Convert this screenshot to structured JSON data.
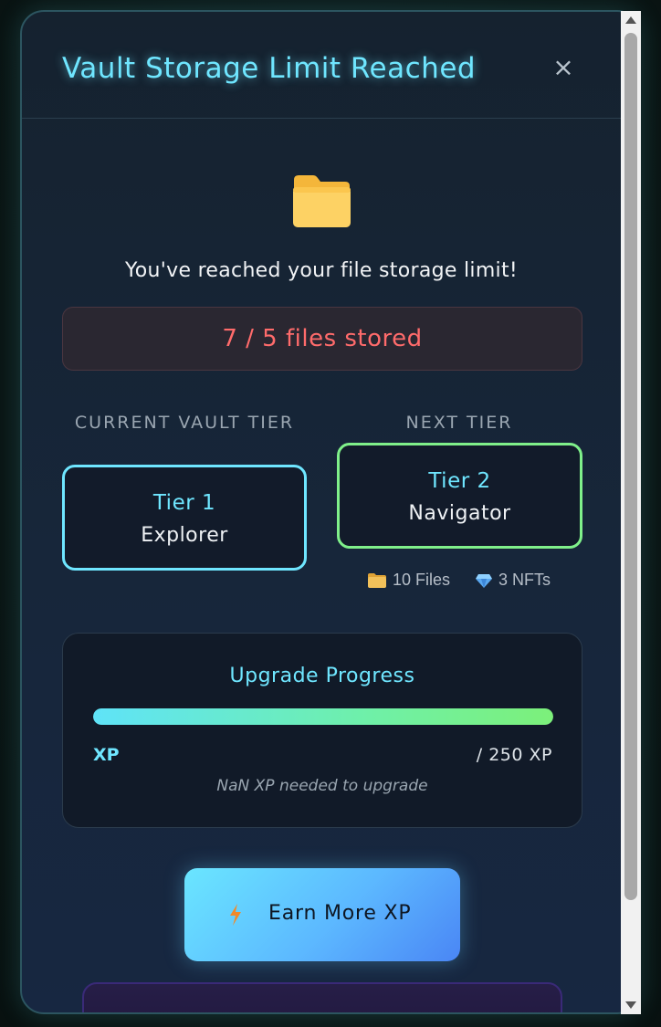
{
  "modal": {
    "title": "Vault Storage Limit Reached",
    "close_symbol": "×",
    "icon": "folder-icon",
    "message": "You've reached your file storage limit!",
    "files_stored": "7 / 5 files stored"
  },
  "tiers": {
    "current": {
      "label": "CURRENT VAULT TIER",
      "name": "Tier 1",
      "description": "Explorer",
      "border_color": "#6fe6ff"
    },
    "next": {
      "label": "NEXT TIER",
      "name": "Tier 2",
      "description": "Navigator",
      "border_color": "#7ff08a",
      "perks": {
        "files": {
          "icon": "folder-icon",
          "text": "10 Files"
        },
        "nfts": {
          "icon": "gem-icon",
          "text": "3 NFTs"
        }
      }
    }
  },
  "progress": {
    "title": "Upgrade Progress",
    "fill_fraction": 1.0,
    "current_xp": "XP",
    "target_xp": "/ 250 XP",
    "needed": "NaN XP needed to upgrade"
  },
  "actions": {
    "earn_button": {
      "label": "Earn More XP",
      "icon": "lightning-icon"
    }
  },
  "colors": {
    "accent_cyan": "#6fe6ff",
    "accent_green": "#7ff08a",
    "error_red": "#ff6b6b"
  }
}
